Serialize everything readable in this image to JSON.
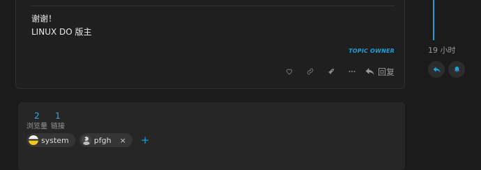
{
  "post": {
    "line1": "谢谢！",
    "line2": "LINUX DO 版主",
    "owner_badge": "TOPIC OWNER",
    "reply_label": "回复"
  },
  "icons": {
    "like": "heart-icon",
    "link": "link-icon",
    "boost": "rocket-icon",
    "more": "ellipsis-icon",
    "reply": "reply-arrow-icon",
    "notify": "bell-icon"
  },
  "timeline": {
    "date": "19 小时"
  },
  "stats": {
    "views": {
      "value": "2",
      "label": "浏览量"
    },
    "links": {
      "value": "1",
      "label": "链接"
    }
  },
  "participants": [
    {
      "name": "system"
    },
    {
      "name": "pfgh"
    }
  ],
  "chip_close": "×",
  "add_label": "+",
  "colors": {
    "accent": "#1e9fd6",
    "background": "#1b1b1b",
    "card": "#262626"
  }
}
